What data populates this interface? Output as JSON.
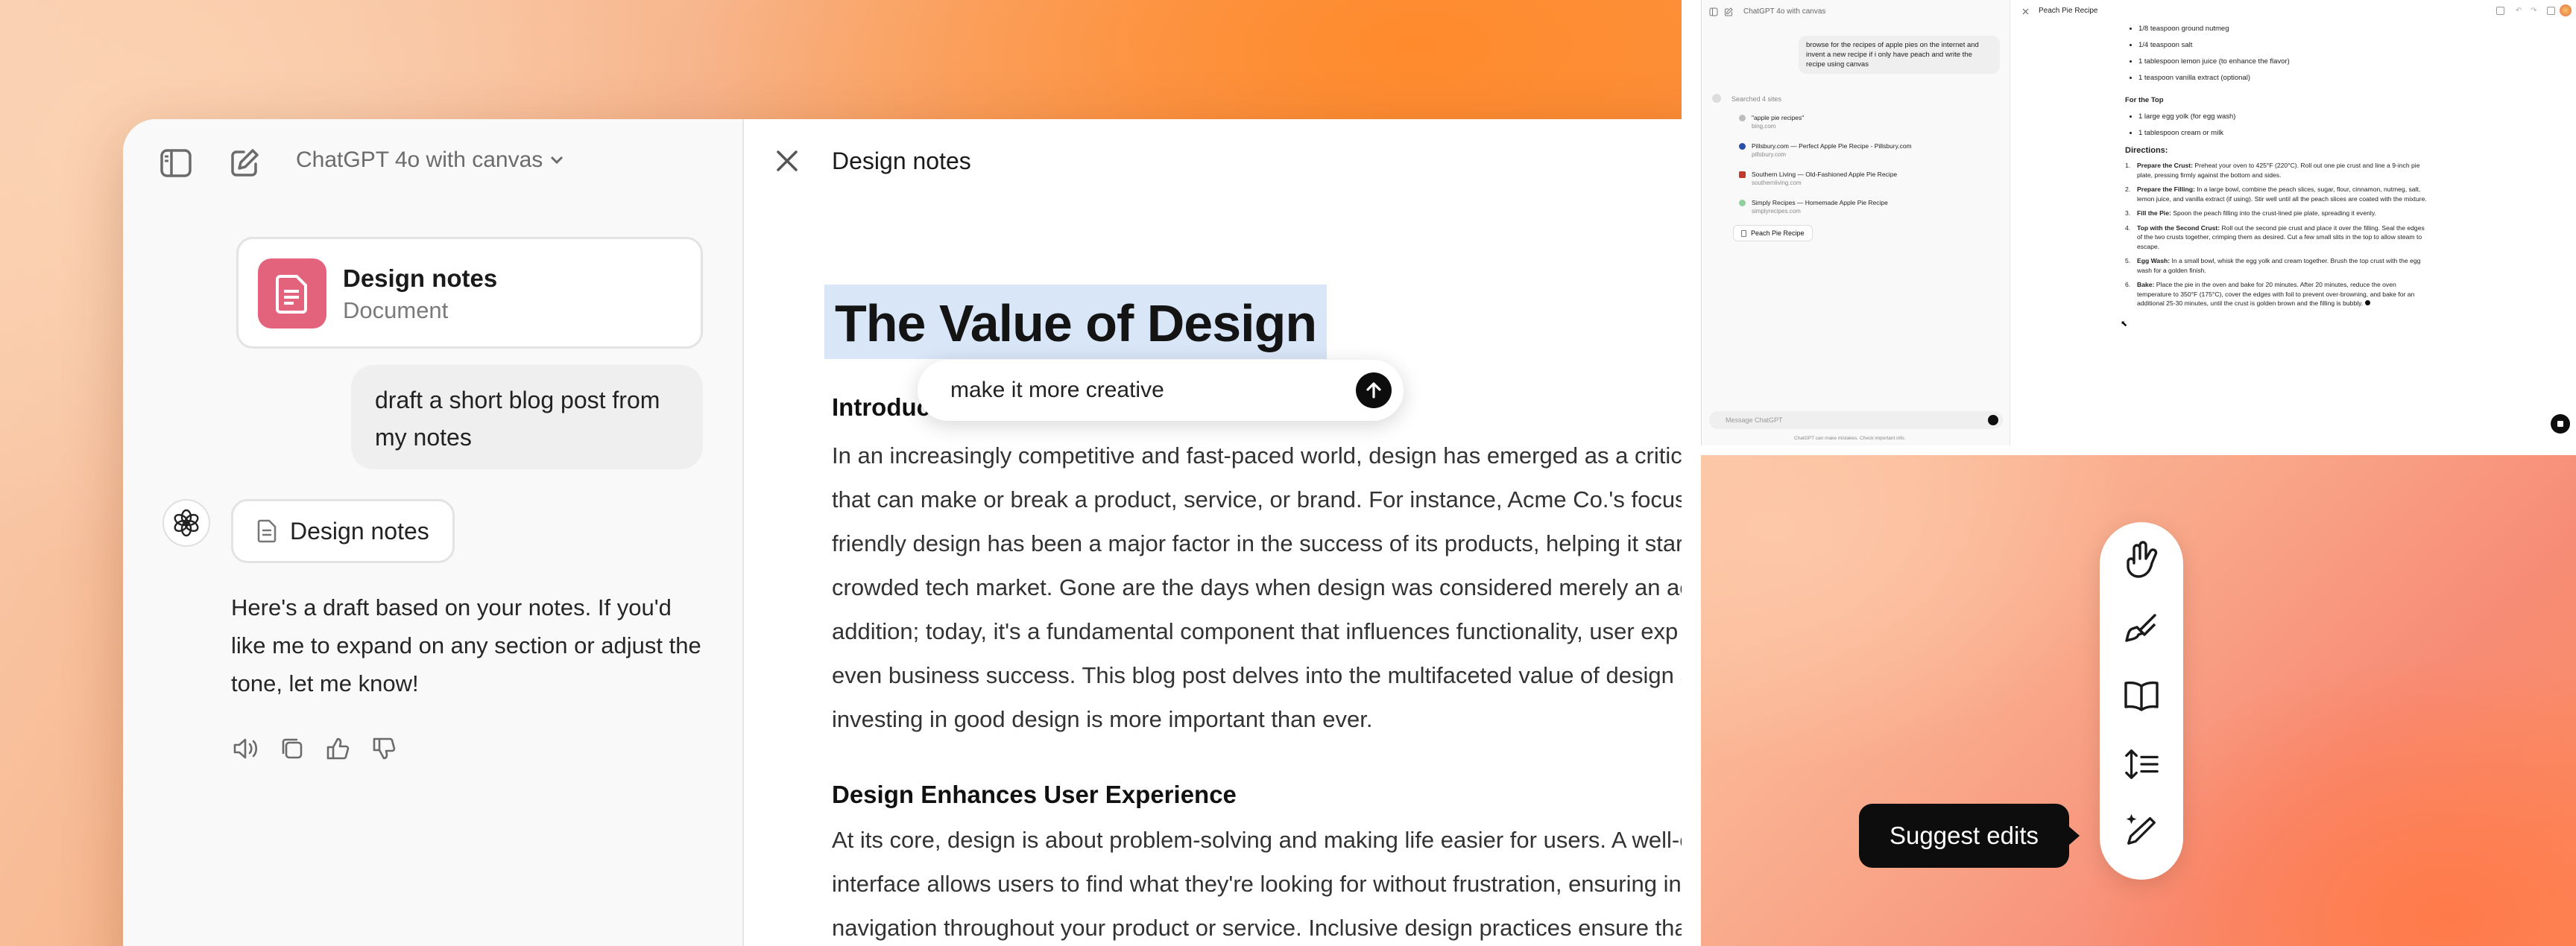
{
  "left": {
    "model_name": "ChatGPT 4o with canvas",
    "doc_card": {
      "title": "Design notes",
      "subtitle": "Document"
    },
    "user_message": "draft a short blog post from my notes",
    "doc_pill": "Design notes",
    "assistant_message": "Here's a draft based on your notes. If you'd like me to expand on any section or adjust the tone, let me know!",
    "canvas_title": "Design notes",
    "doc_heading": "The Value of Design",
    "inline_prompt": "make it more creative",
    "intro_heading": "Introduc",
    "intro_lines": [
      "In an increasingly competitive and fast-paced world, design has emerged as a critic",
      "that can make or break a product, service, or brand. For instance, Acme Co.'s focus o",
      "friendly design has been a major factor in the success of its products, helping it star",
      "crowded tech market. Gone are the days when design was considered merely an ae",
      "addition; today, it's a fundamental component that influences functionality, user exp",
      "even business success. This blog post delves into the multifaceted value of design a",
      "investing in good design is more important than ever."
    ],
    "section_heading": "Design Enhances User Experience",
    "section_lines": [
      "At its core, design is about problem-solving and making life easier for users. A well-c",
      "interface allows users to find what they're looking for without frustration, ensuring in",
      "navigation throughout your product or service. Inclusive design practices ensure tha"
    ]
  },
  "right_top": {
    "model_name": "ChatGPT 4o with canvas",
    "user_message": "browse for the recipes of apple pies on the internet and invent a new recipe if i only have peach and write the recipe using canvas",
    "searched_label": "Searched 4 sites",
    "sites": [
      {
        "title": "\"apple pie recipes\"",
        "domain": "bing.com",
        "color": "#bdbdbd"
      },
      {
        "title": "Pillsbury.com — Perfect Apple Pie Recipe - Pillsbury.com",
        "domain": "pillsbury.com",
        "color": "#2a4fa8"
      },
      {
        "title": "Southern Living — Old-Fashioned Apple Pie Recipe",
        "domain": "southernliving.com",
        "color": "#c0392b"
      },
      {
        "title": "Simply Recipes — Homemade Apple Pie Recipe",
        "domain": "simplyrecipes.com",
        "color": "#8fd19e"
      }
    ],
    "doc_pill": "Peach Pie Recipe",
    "composer_placeholder": "Message ChatGPT",
    "disclaimer": "ChatGPT can make mistakes. Check important info.",
    "canvas_title": "Peach Pie Recipe",
    "ingredients_tail": [
      "1/8 teaspoon ground nutmeg",
      "1/4 teaspoon salt",
      "1 tablespoon lemon juice (to enhance the flavor)",
      "1 teaspoon vanilla extract (optional)"
    ],
    "for_top_heading": "For the Top",
    "for_top_items": [
      "1 large egg yolk (for egg wash)",
      "1 tablespoon cream or milk"
    ],
    "directions_heading": "Directions:",
    "directions": [
      {
        "label": "Prepare the Crust:",
        "lines": [
          "Preheat your oven to 425°F (220°C). Roll out one pie crust and line a 9-inch pie",
          "plate, pressing firmly against the bottom and sides."
        ]
      },
      {
        "label": "Prepare the Filling:",
        "lines": [
          "In a large bowl, combine the peach slices, sugar, flour, cinnamon, nutmeg, salt,",
          "lemon juice, and vanilla extract (if using). Stir well until all the peach slices are coated with the mixture."
        ]
      },
      {
        "label": "Fill the Pie:",
        "lines": [
          "Spoon the peach filling into the crust-lined pie plate, spreading it evenly."
        ]
      },
      {
        "label": "Top with the Second Crust:",
        "lines": [
          "Roll out the second pie crust and place it over the filling. Seal the edges",
          "of the two crusts together, crimping them as desired. Cut a few small slits in the top to allow steam to",
          "escape."
        ]
      },
      {
        "label": "Egg Wash:",
        "lines": [
          "In a small bowl, whisk the egg yolk and cream together. Brush the top crust with the egg",
          "wash for a golden finish."
        ]
      },
      {
        "label": "Bake:",
        "lines": [
          "Place the pie in the oven and bake for 20 minutes. After 20 minutes, reduce the oven",
          "temperature to 350°F (175°C), cover the edges with foil to prevent over-browning, and bake for an",
          "additional 25-30 minutes, until the crust is golden brown and the filling is bubbly."
        ]
      }
    ]
  },
  "right_bottom": {
    "tooltip": "Suggest edits",
    "tools": [
      "emoji-icon",
      "paintbrush-icon",
      "book-icon",
      "length-icon",
      "suggest-edits-icon"
    ]
  }
}
